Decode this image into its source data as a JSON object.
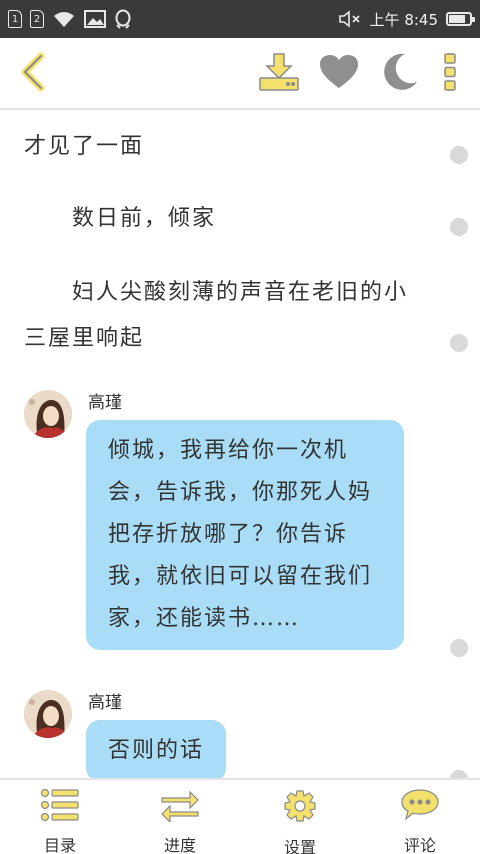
{
  "status_bar": {
    "sim1": "1",
    "sim2": "2",
    "time": "上午 8:45",
    "battery_level": 0.9,
    "icons": [
      "sim1-icon",
      "sim2-icon",
      "wifi-icon",
      "image-icon",
      "qq-icon",
      "mute-icon",
      "battery-icon"
    ]
  },
  "toolbar": {
    "icons": [
      "back-icon",
      "download-icon",
      "heart-icon",
      "moon-icon",
      "more-icon"
    ],
    "accent_color": "#f3e06d",
    "icon_color": "#8f8f8f"
  },
  "content": {
    "paragraphs": [
      {
        "text": "才见了一面"
      },
      {
        "text": "　　数日前，倾家"
      },
      {
        "text": "　　妇人尖酸刻薄的声音在老旧的小三屋里响起"
      }
    ],
    "messages": [
      {
        "speaker": "高瑾",
        "text": "倾城，我再给你一次机会，告诉我，你那死人妈把存折放哪了？你告诉我，就依旧可以留在我们家，还能读书……"
      },
      {
        "speaker": "高瑾",
        "text": "否则的话"
      }
    ],
    "bubble_color": "#a9dcf6"
  },
  "bottom_nav": {
    "items": [
      {
        "label": "目录",
        "icon": "list-icon"
      },
      {
        "label": "进度",
        "icon": "arrows-icon"
      },
      {
        "label": "设置",
        "icon": "gear-icon"
      },
      {
        "label": "评论",
        "icon": "comment-icon"
      }
    ]
  }
}
